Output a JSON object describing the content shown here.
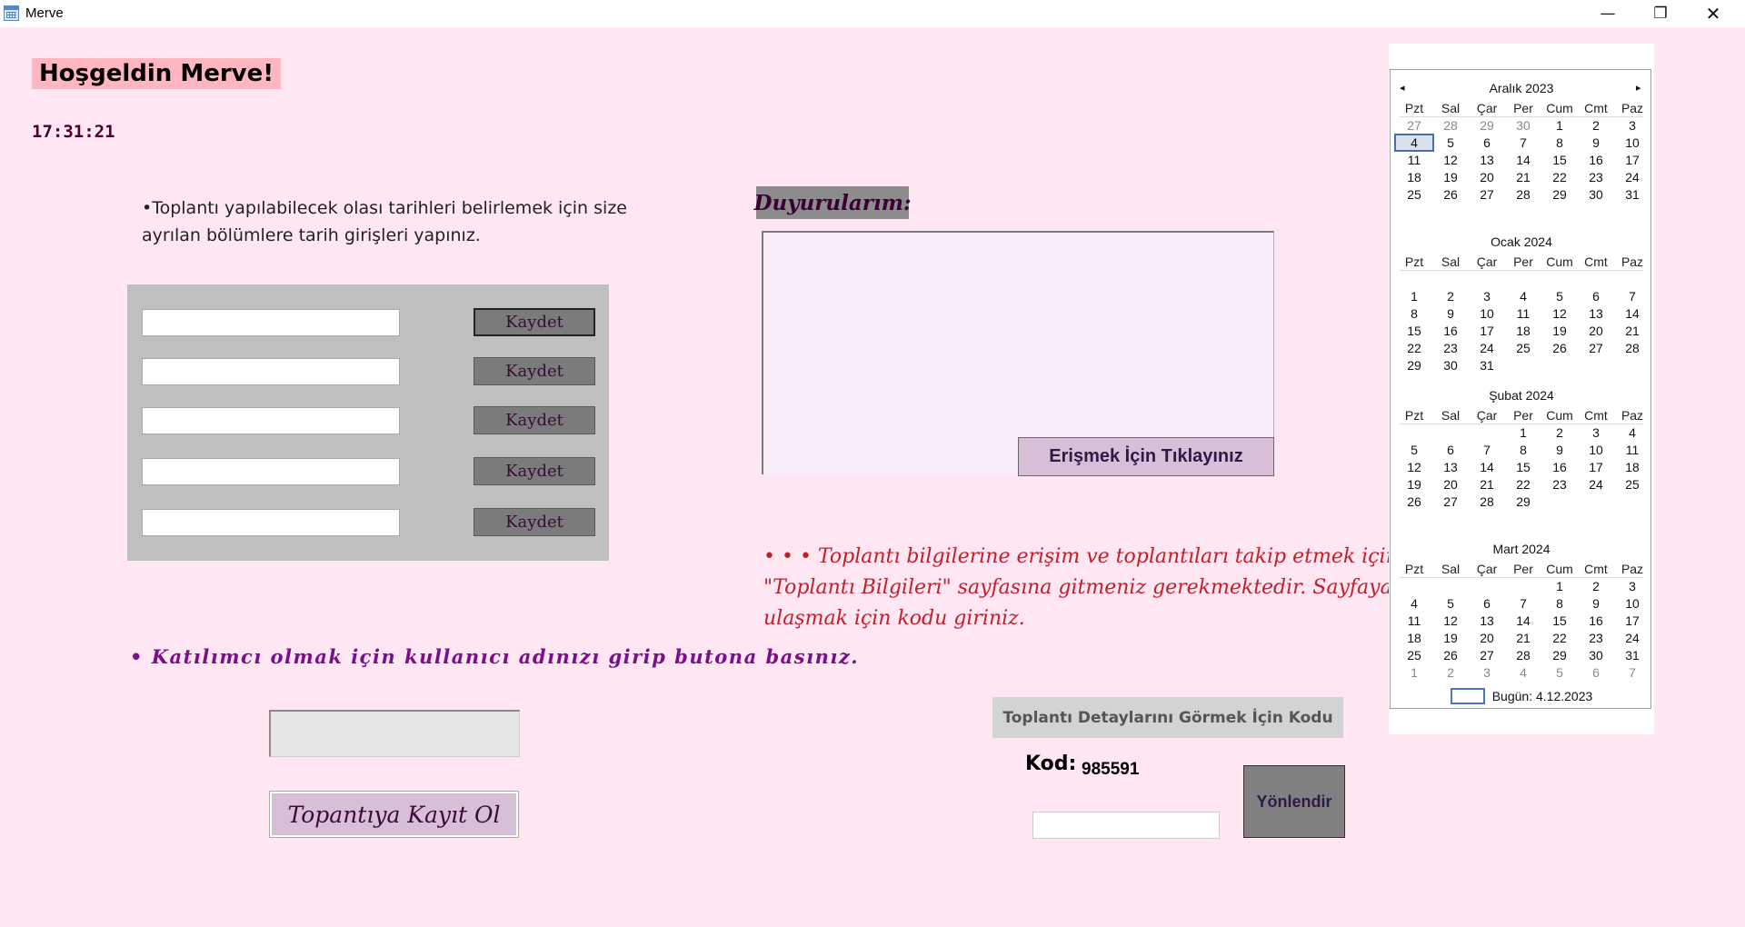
{
  "window": {
    "title": "Merve",
    "minimize_glyph": "—",
    "maximize_glyph": "❐",
    "close_glyph": "✕",
    "icon": "calendar-icon"
  },
  "greeting": "Hoşgeldin Merve!",
  "clock": "17:31:21",
  "date_section": {
    "instruction": "•Toplantı yapılabilecek olası tarihleri belirlemek için size ayrılan bölümlere tarih girişleri yapınız.",
    "rows": [
      {
        "value": "",
        "button": "Kaydet"
      },
      {
        "value": "",
        "button": "Kaydet"
      },
      {
        "value": "",
        "button": "Kaydet"
      },
      {
        "value": "",
        "button": "Kaydet"
      },
      {
        "value": "",
        "button": "Kaydet"
      }
    ]
  },
  "announcements": {
    "label": "Duyurularım:",
    "access_button": "Erişmek İçin Tıklayınız"
  },
  "meeting_info": "• • • Toplantı bilgilerine erişim ve toplantıları takip etmek için \"Toplantı Bilgileri\" sayfasına gitmeniz gerekmektedir. Sayfaya ulaşmak için kodu giriniz.",
  "participant": {
    "instruction": "• Katılımcı olmak için kullanıcı adınızı girip butona basınız.",
    "username_value": "",
    "register_button": "Topantıya Kayıt Ol"
  },
  "code_section": {
    "label": "Toplantı Detaylarını Görmek İçin Kodu",
    "kod_label": "Kod:",
    "kod_value": "985591",
    "input_value": "",
    "redirect_button": "Yönlendir"
  },
  "calendar": {
    "prev_glyph": "◂",
    "next_glyph": "▸",
    "weekdays": [
      "Pzt",
      "Sal",
      "Çar",
      "Per",
      "Cum",
      "Cmt",
      "Paz"
    ],
    "months": [
      {
        "title": "Aralık 2023",
        "weeks": [
          [
            {
              "d": "27",
              "m": 1
            },
            {
              "d": "28",
              "m": 1
            },
            {
              "d": "29",
              "m": 1
            },
            {
              "d": "30",
              "m": 1
            },
            {
              "d": "1"
            },
            {
              "d": "2"
            },
            {
              "d": "3"
            }
          ],
          [
            {
              "d": "4",
              "t": 1
            },
            {
              "d": "5"
            },
            {
              "d": "6"
            },
            {
              "d": "7"
            },
            {
              "d": "8"
            },
            {
              "d": "9"
            },
            {
              "d": "10"
            }
          ],
          [
            {
              "d": "11"
            },
            {
              "d": "12"
            },
            {
              "d": "13"
            },
            {
              "d": "14"
            },
            {
              "d": "15"
            },
            {
              "d": "16"
            },
            {
              "d": "17"
            }
          ],
          [
            {
              "d": "18"
            },
            {
              "d": "19"
            },
            {
              "d": "20"
            },
            {
              "d": "21"
            },
            {
              "d": "22"
            },
            {
              "d": "23"
            },
            {
              "d": "24"
            }
          ],
          [
            {
              "d": "25"
            },
            {
              "d": "26"
            },
            {
              "d": "27"
            },
            {
              "d": "28"
            },
            {
              "d": "29"
            },
            {
              "d": "30"
            },
            {
              "d": "31"
            }
          ]
        ]
      },
      {
        "title": "Ocak 2024",
        "weeks": [
          [
            {
              "d": ""
            },
            {
              "d": ""
            },
            {
              "d": ""
            },
            {
              "d": ""
            },
            {
              "d": ""
            },
            {
              "d": ""
            },
            {
              "d": ""
            }
          ],
          [
            {
              "d": "1"
            },
            {
              "d": "2"
            },
            {
              "d": "3"
            },
            {
              "d": "4"
            },
            {
              "d": "5"
            },
            {
              "d": "6"
            },
            {
              "d": "7"
            }
          ],
          [
            {
              "d": "8"
            },
            {
              "d": "9"
            },
            {
              "d": "10"
            },
            {
              "d": "11"
            },
            {
              "d": "12"
            },
            {
              "d": "13"
            },
            {
              "d": "14"
            }
          ],
          [
            {
              "d": "15"
            },
            {
              "d": "16"
            },
            {
              "d": "17"
            },
            {
              "d": "18"
            },
            {
              "d": "19"
            },
            {
              "d": "20"
            },
            {
              "d": "21"
            }
          ],
          [
            {
              "d": "22"
            },
            {
              "d": "23"
            },
            {
              "d": "24"
            },
            {
              "d": "25"
            },
            {
              "d": "26"
            },
            {
              "d": "27"
            },
            {
              "d": "28"
            }
          ],
          [
            {
              "d": "29"
            },
            {
              "d": "30"
            },
            {
              "d": "31"
            },
            {
              "d": ""
            },
            {
              "d": ""
            },
            {
              "d": ""
            },
            {
              "d": ""
            }
          ]
        ]
      },
      {
        "title": "Şubat 2024",
        "weeks": [
          [
            {
              "d": ""
            },
            {
              "d": ""
            },
            {
              "d": ""
            },
            {
              "d": "1"
            },
            {
              "d": "2"
            },
            {
              "d": "3"
            },
            {
              "d": "4"
            }
          ],
          [
            {
              "d": "5"
            },
            {
              "d": "6"
            },
            {
              "d": "7"
            },
            {
              "d": "8"
            },
            {
              "d": "9"
            },
            {
              "d": "10"
            },
            {
              "d": "11"
            }
          ],
          [
            {
              "d": "12"
            },
            {
              "d": "13"
            },
            {
              "d": "14"
            },
            {
              "d": "15"
            },
            {
              "d": "16"
            },
            {
              "d": "17"
            },
            {
              "d": "18"
            }
          ],
          [
            {
              "d": "19"
            },
            {
              "d": "20"
            },
            {
              "d": "21"
            },
            {
              "d": "22"
            },
            {
              "d": "23"
            },
            {
              "d": "24"
            },
            {
              "d": "25"
            }
          ],
          [
            {
              "d": "26"
            },
            {
              "d": "27"
            },
            {
              "d": "28"
            },
            {
              "d": "29"
            },
            {
              "d": ""
            },
            {
              "d": ""
            },
            {
              "d": ""
            }
          ]
        ]
      },
      {
        "title": "Mart 2024",
        "weeks": [
          [
            {
              "d": ""
            },
            {
              "d": ""
            },
            {
              "d": ""
            },
            {
              "d": ""
            },
            {
              "d": "1"
            },
            {
              "d": "2"
            },
            {
              "d": "3"
            }
          ],
          [
            {
              "d": "4"
            },
            {
              "d": "5"
            },
            {
              "d": "6"
            },
            {
              "d": "7"
            },
            {
              "d": "8"
            },
            {
              "d": "9"
            },
            {
              "d": "10"
            }
          ],
          [
            {
              "d": "11"
            },
            {
              "d": "12"
            },
            {
              "d": "13"
            },
            {
              "d": "14"
            },
            {
              "d": "15"
            },
            {
              "d": "16"
            },
            {
              "d": "17"
            }
          ],
          [
            {
              "d": "18"
            },
            {
              "d": "19"
            },
            {
              "d": "20"
            },
            {
              "d": "21"
            },
            {
              "d": "22"
            },
            {
              "d": "23"
            },
            {
              "d": "24"
            }
          ],
          [
            {
              "d": "25"
            },
            {
              "d": "26"
            },
            {
              "d": "27"
            },
            {
              "d": "28"
            },
            {
              "d": "29"
            },
            {
              "d": "30"
            },
            {
              "d": "31"
            }
          ],
          [
            {
              "d": "1",
              "m": 1
            },
            {
              "d": "2",
              "m": 1
            },
            {
              "d": "3",
              "m": 1
            },
            {
              "d": "4",
              "m": 1
            },
            {
              "d": "5",
              "m": 1
            },
            {
              "d": "6",
              "m": 1
            },
            {
              "d": "7",
              "m": 1
            }
          ]
        ]
      }
    ],
    "today_label": "Bugün: 4.12.2023"
  },
  "colors": {
    "background": "#ffe6f3",
    "accent_button": "#d8bfd8",
    "panel": "#bfbfbf",
    "meeting_info_text": "#c0202a",
    "participant_text": "#7a0f8c"
  }
}
